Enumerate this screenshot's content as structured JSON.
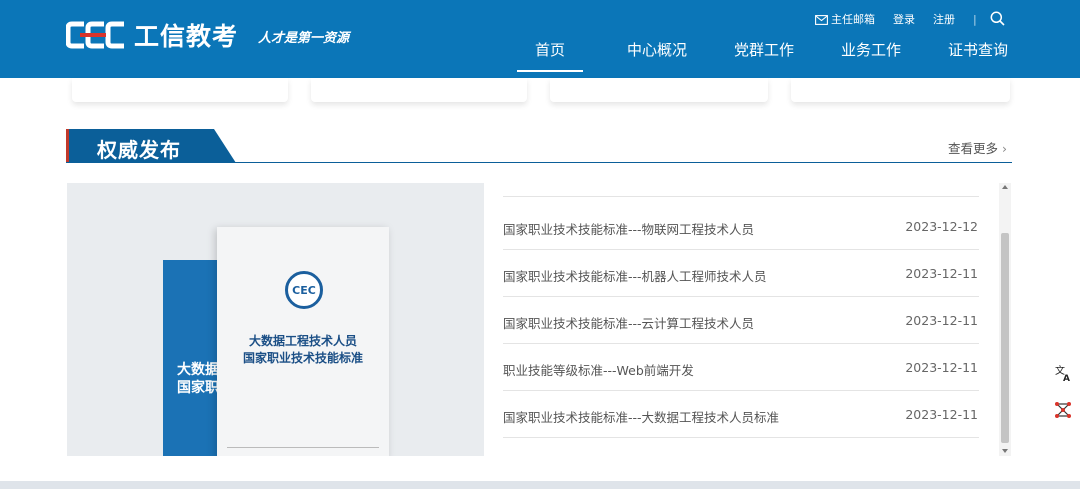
{
  "header": {
    "brand_name": "工信教考",
    "slogan": "人才是第一资源",
    "logo_icon": "cec-logo-icon",
    "top_links": {
      "mailbox": "主任邮箱",
      "login": "登录",
      "register": "注册",
      "separator": "|"
    },
    "nav": [
      "首页",
      "中心概况",
      "党群工作",
      "业务工作",
      "证书查询"
    ],
    "active_nav": "首页",
    "colors": {
      "bar": "#0b76b8"
    }
  },
  "section": {
    "title": "权威发布",
    "more_label": "查看更多",
    "colors": {
      "tab": "#0b5f99",
      "accent": "#c0392b"
    }
  },
  "cover": {
    "back_text": "大数据\n国家职",
    "seal_text": "CEC",
    "title": "大数据工程技术人员\n国家职业技术技能标准"
  },
  "news": {
    "items": [
      {
        "title": "国家职业技术技能标准---物联网工程技术人员",
        "date": "2023-12-12"
      },
      {
        "title": "国家职业技术技能标准---机器人工程师技术人员",
        "date": "2023-12-11"
      },
      {
        "title": "国家职业技术技能标准---云计算工程技术人员",
        "date": "2023-12-11"
      },
      {
        "title": "职业技能等级标准---Web前端开发",
        "date": "2023-12-11"
      },
      {
        "title": "国家职业技术技能标准---大数据工程技术人员标准",
        "date": "2023-12-11"
      }
    ]
  },
  "float_buttons": [
    "translate-icon",
    "network-icon"
  ]
}
